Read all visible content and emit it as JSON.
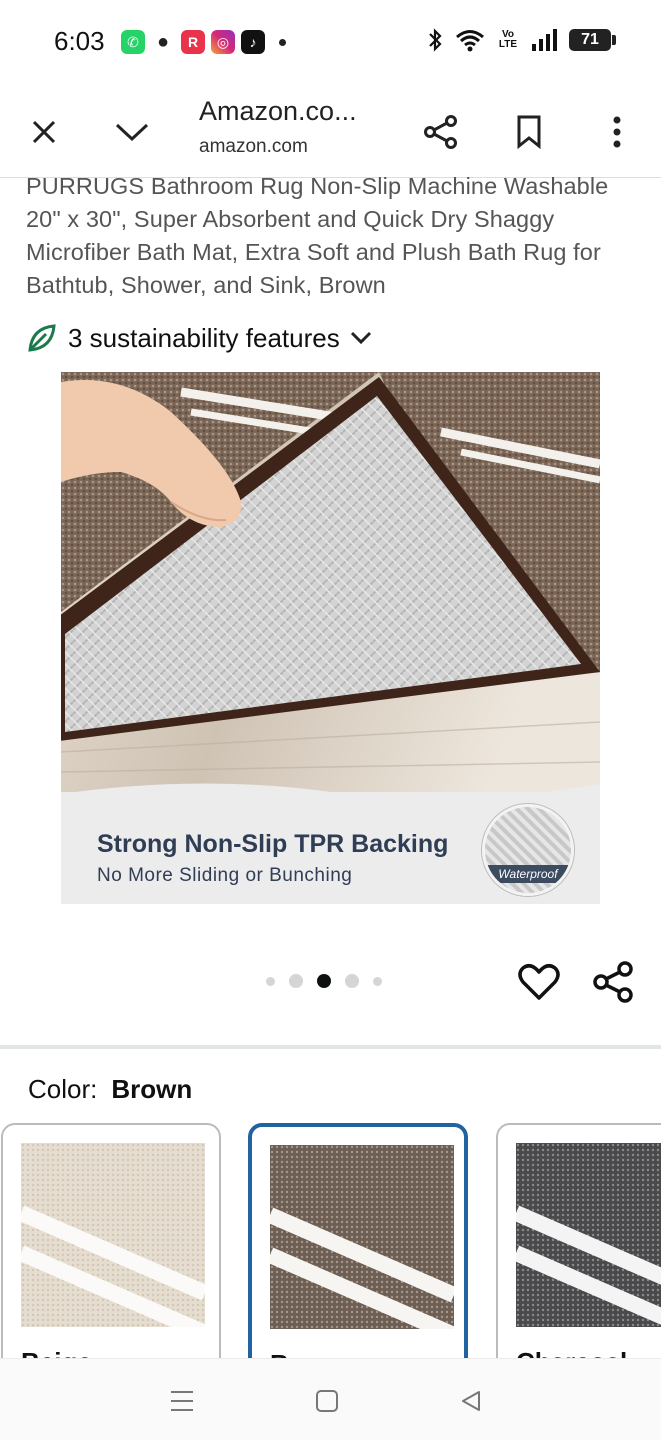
{
  "status_bar": {
    "time": "6:03",
    "battery": "71",
    "network_label": "Vo LTE"
  },
  "browser": {
    "page_title": "Amazon.co...",
    "domain": "amazon.com"
  },
  "product": {
    "title": "PURRUGS Bathroom Rug Non-Slip Machine Washable 20\" x 30\", Super Absorbent and Quick Dry Shaggy Microfiber Bath Mat, Extra Soft and Plush Bath Rug for Bathtub, Shower, and Sink, Brown",
    "sustainability_label": "3 sustainability features",
    "image_caption_main": "Strong Non-Slip TPR Backing",
    "image_caption_sub": "No More Sliding or Bunching",
    "badge_text": "Waterproof",
    "carousel_total": 5,
    "carousel_active_index": 2
  },
  "color_selector": {
    "label": "Color:",
    "selected_value": "Brown",
    "options": [
      {
        "name": "Beige",
        "color": "#e6ddd1"
      },
      {
        "name": "Brown",
        "color": "#6e5f55"
      },
      {
        "name": "Charcoal",
        "color": "#4a4a4c"
      }
    ]
  },
  "colors": {
    "accent_blue": "#2162a1",
    "sustain_green": "#1a7a4c",
    "caption_navy": "#2f3d55"
  }
}
